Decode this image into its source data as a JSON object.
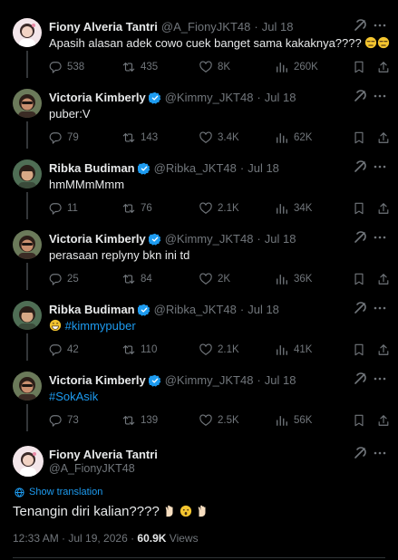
{
  "tweets": [
    {
      "name": "Fiony Alveria Tantri",
      "verified": false,
      "handle": "@A_FionyJKT48",
      "dot": "·",
      "time": "Jul 18",
      "text": "Apasih alasan adek cowo cuek banget sama kakaknya????",
      "emoji_after": [
        "unamused-face",
        "unamused-face"
      ],
      "replies": "538",
      "retweets": "435",
      "likes": "8K",
      "views": "260K",
      "avatar": "fiony"
    },
    {
      "name": "Victoria Kimberly",
      "verified": true,
      "handle": "@Kimmy_JKT48",
      "dot": "·",
      "time": "Jul 18",
      "text": "puber:V",
      "replies": "79",
      "retweets": "143",
      "likes": "3.4K",
      "views": "62K",
      "avatar": "kimmy"
    },
    {
      "name": "Ribka Budiman",
      "verified": true,
      "handle": "@Ribka_JKT48",
      "dot": "·",
      "time": "Jul 18",
      "text": "hmMMmMmm",
      "replies": "11",
      "retweets": "76",
      "likes": "2.1K",
      "views": "34K",
      "avatar": "ribka"
    },
    {
      "name": "Victoria Kimberly",
      "verified": true,
      "handle": "@Kimmy_JKT48",
      "dot": "·",
      "time": "Jul 18",
      "text": "perasaan replyny bkn ini td",
      "replies": "25",
      "retweets": "84",
      "likes": "2K",
      "views": "36K",
      "avatar": "kimmy"
    },
    {
      "name": "Ribka Budiman",
      "verified": true,
      "handle": "@Ribka_JKT48",
      "dot": "·",
      "time": "Jul 18",
      "hashtag": "#kimmypuber",
      "emoji_before": "grinning-face",
      "replies": "42",
      "retweets": "110",
      "likes": "2.1K",
      "views": "41K",
      "avatar": "ribka"
    },
    {
      "name": "Victoria Kimberly",
      "verified": true,
      "handle": "@Kimmy_JKT48",
      "dot": "·",
      "time": "Jul 18",
      "hashtag": "#SokAsik",
      "replies": "73",
      "retweets": "139",
      "likes": "2.5K",
      "views": "56K",
      "avatar": "kimmy"
    }
  ],
  "focus": {
    "name": "Fiony Alveria Tantri",
    "handle": "@A_FionyJKT48",
    "translate": "Show translation",
    "text": "Tenangin diri kalian????",
    "emoji_after": [
      "raised-hand",
      "hushed-face",
      "raised-hand"
    ],
    "date": "12:33 AM · Jul 19, 2026 · ",
    "views_count": "60.9K",
    "views_label": "Views"
  },
  "colors": {
    "background": "#000000",
    "text": "#e7e9ea",
    "muted": "#71767b",
    "accent": "#1d9bf0",
    "verified": "#1d9bf0",
    "thread_line": "#333639"
  }
}
